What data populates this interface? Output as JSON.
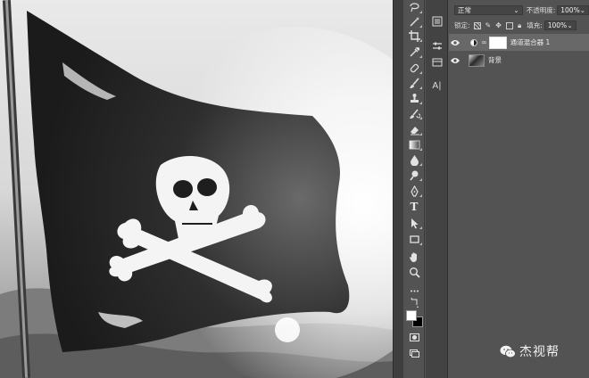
{
  "layers_panel": {
    "blend_mode": "正常",
    "opacity_label": "不透明度:",
    "opacity_value": "100%",
    "lock_label": "锁定:",
    "fill_label": "填充:",
    "fill_value": "100%",
    "layers": [
      {
        "name": "通道混合器 1",
        "visible": true,
        "type": "adjustment"
      },
      {
        "name": "背景",
        "visible": true,
        "type": "image"
      }
    ]
  },
  "tools": [
    "move-tool",
    "marquee-tool",
    "lasso-tool",
    "magic-wand-tool",
    "crop-tool",
    "eyedropper-tool",
    "healing-brush-tool",
    "brush-tool",
    "clone-stamp-tool",
    "history-brush-tool",
    "eraser-tool",
    "gradient-tool",
    "blur-tool",
    "dodge-tool",
    "pen-tool",
    "type-tool",
    "path-selection-tool",
    "rectangle-tool",
    "hand-tool",
    "zoom-tool",
    "more-tools"
  ],
  "type_tool_glyph": "T",
  "char_panel_glyph": "A|",
  "colors": {
    "foreground": "#ffffff",
    "background": "#000000",
    "panel": "#535353"
  },
  "watermark": {
    "text": "杰视帮"
  }
}
